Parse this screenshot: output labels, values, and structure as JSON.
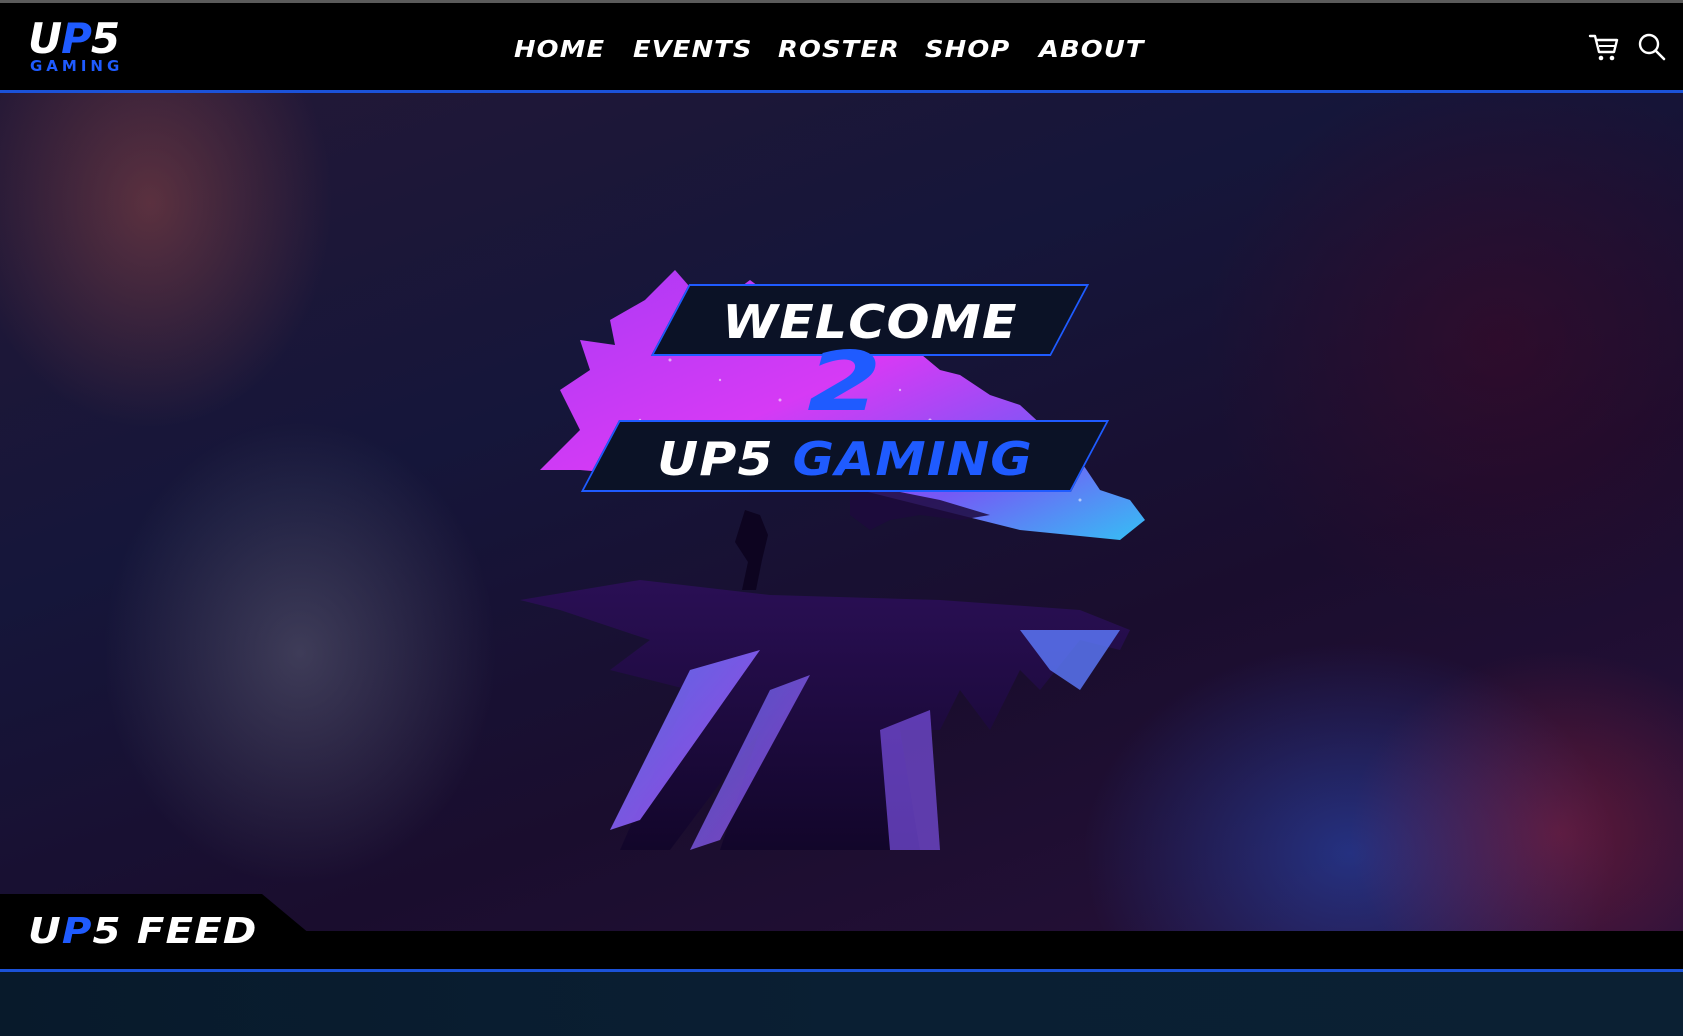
{
  "header": {
    "logo": {
      "main_prefix": "U",
      "main_accent": "P",
      "main_suffix": "5",
      "sub": "GAMING"
    },
    "nav": [
      {
        "label": "HOME"
      },
      {
        "label": "EVENTS"
      },
      {
        "label": "ROSTER"
      },
      {
        "label": "SHOP"
      },
      {
        "label": "ABOUT"
      }
    ],
    "icons": {
      "cart": "cart-icon",
      "search": "search-icon"
    }
  },
  "hero": {
    "welcome": "WELCOME",
    "two": "2",
    "brand_white": "UP5",
    "brand_blue": "GAMING",
    "art": "wolf-silhouette-artwork"
  },
  "feed": {
    "title_prefix": "U",
    "title_accent": "P",
    "title_suffix": "5 FEED"
  },
  "colors": {
    "accent": "#1f5bff",
    "header_bg": "#000000",
    "hero_purple": "#1a0d2e",
    "art_pink": "#e03cff",
    "art_cyan": "#37c8ff"
  }
}
